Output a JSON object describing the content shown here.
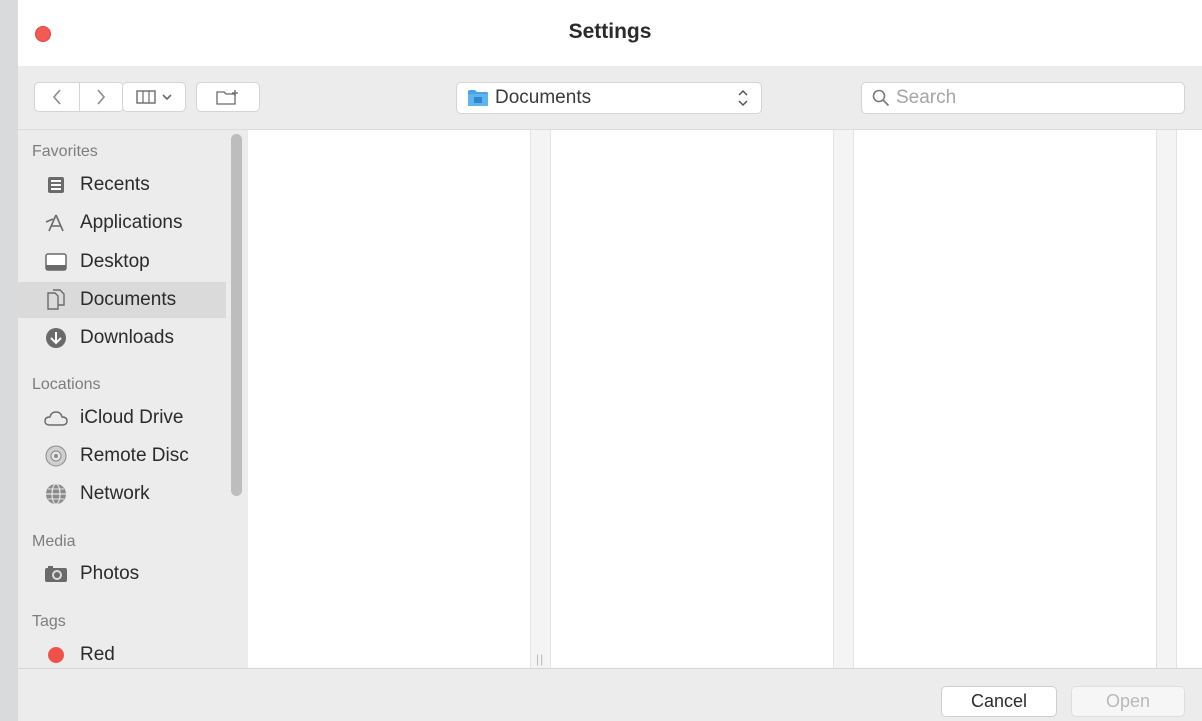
{
  "window": {
    "title": "Settings"
  },
  "toolbar": {
    "location": "Documents",
    "search_placeholder": "Search"
  },
  "sidebar": {
    "sections": [
      {
        "header": "Favorites",
        "items": [
          {
            "label": "Recents",
            "icon": "recents-icon"
          },
          {
            "label": "Applications",
            "icon": "applications-icon"
          },
          {
            "label": "Desktop",
            "icon": "desktop-icon"
          },
          {
            "label": "Documents",
            "icon": "documents-icon",
            "selected": true
          },
          {
            "label": "Downloads",
            "icon": "downloads-icon"
          }
        ]
      },
      {
        "header": "Locations",
        "items": [
          {
            "label": "iCloud Drive",
            "icon": "cloud-icon"
          },
          {
            "label": "Remote Disc",
            "icon": "disc-icon"
          },
          {
            "label": "Network",
            "icon": "network-icon"
          }
        ]
      },
      {
        "header": "Media",
        "items": [
          {
            "label": "Photos",
            "icon": "camera-icon"
          }
        ]
      },
      {
        "header": "Tags",
        "items": [
          {
            "label": "Red",
            "icon": "red-tag-icon",
            "color": "#f0524b"
          }
        ]
      }
    ]
  },
  "footer": {
    "cancel_label": "Cancel",
    "open_label": "Open"
  }
}
